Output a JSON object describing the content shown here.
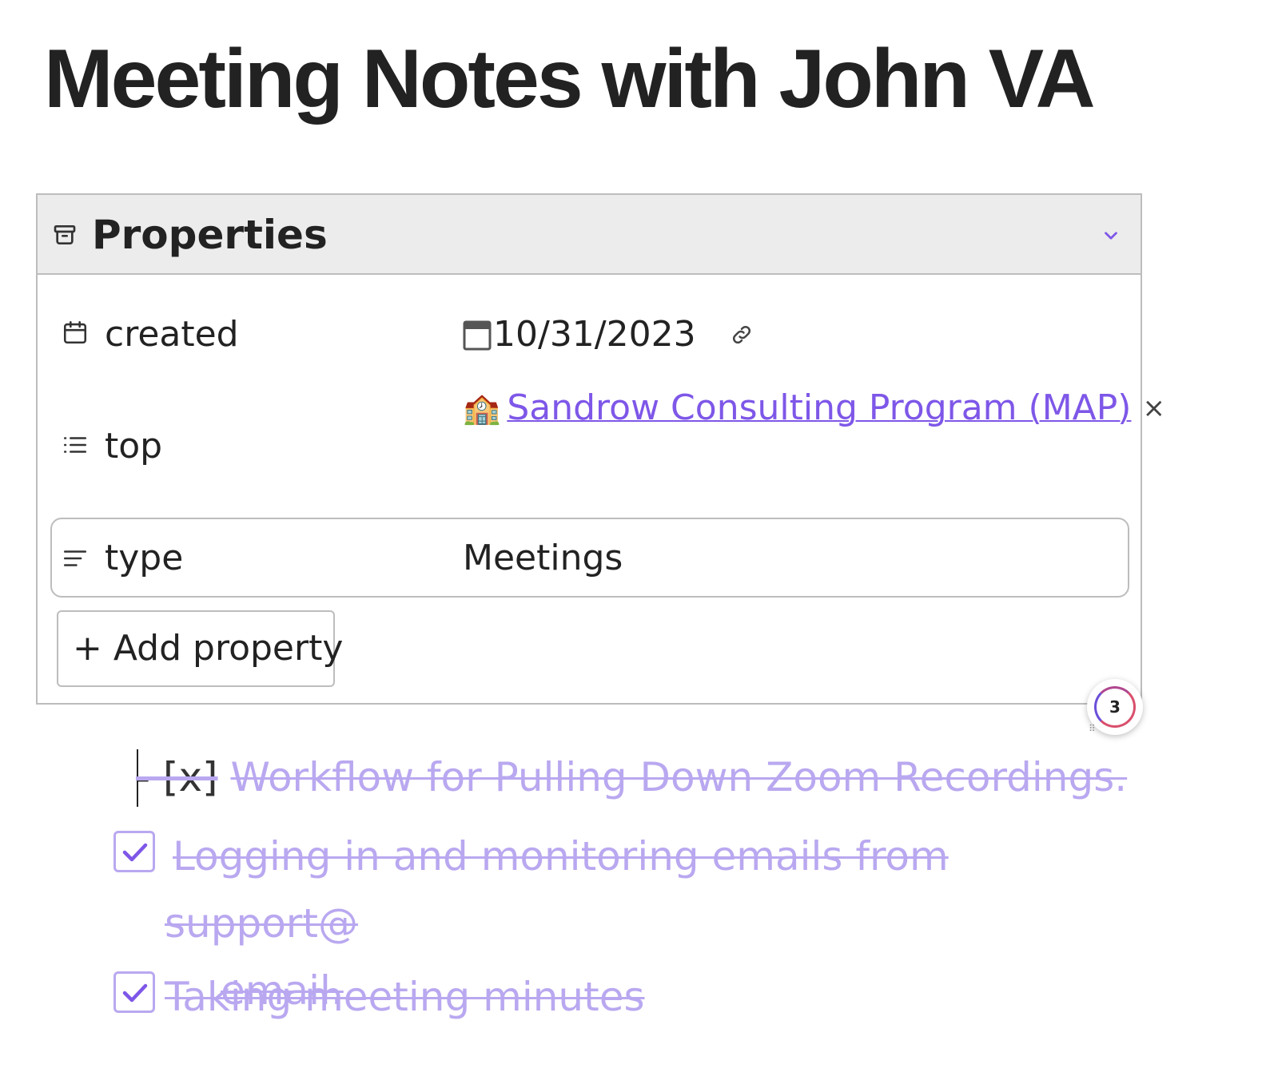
{
  "page": {
    "title": "Meeting Notes with John VA"
  },
  "properties": {
    "heading": "Properties",
    "rows": [
      {
        "key": "created",
        "value": "10/31/2023"
      },
      {
        "key": "top",
        "value": "Sandrow Consulting Program (MAP)",
        "emoji": "🏫"
      },
      {
        "key": "type",
        "value": "Meetings"
      }
    ],
    "add_label": "+ Add property"
  },
  "badge": {
    "count": "3"
  },
  "tasks": {
    "raw_line": {
      "prefix": "- [x]",
      "text": "Workflow for Pulling Down Zoom Recordings."
    },
    "items": [
      {
        "line1": "Logging in and monitoring emails from support@",
        "line2": "email.",
        "checked": true
      },
      {
        "text": "Taking meeting minutes",
        "checked": true
      }
    ]
  },
  "colors": {
    "accent": "#7e57e8",
    "done_text": "#b9a8f0",
    "header_bg": "#ececec",
    "border": "#bdbdbd"
  }
}
